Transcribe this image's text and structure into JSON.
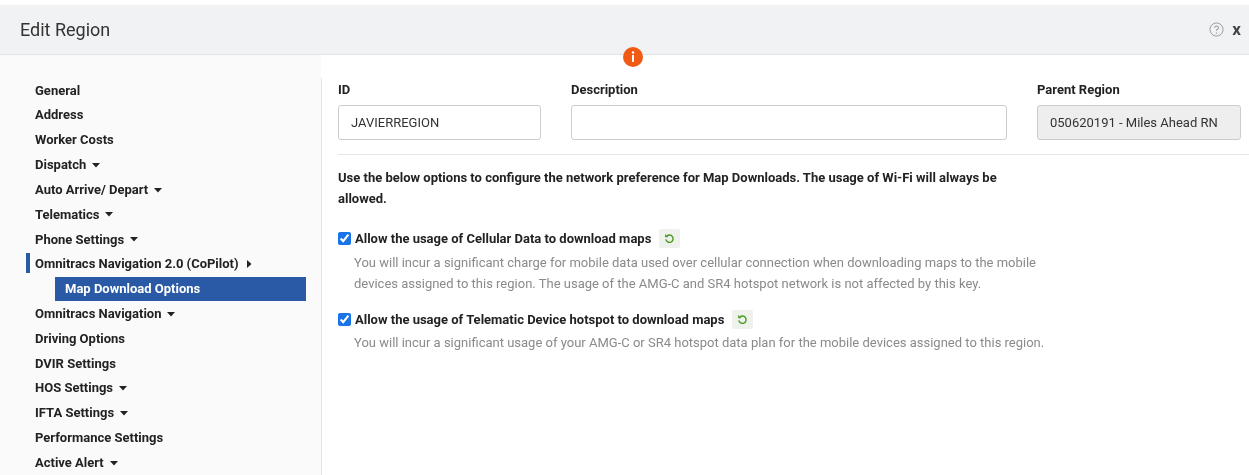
{
  "window": {
    "title": "Edit Region",
    "close": "x"
  },
  "sidebar": {
    "items": [
      {
        "label": "General",
        "kind": "plain",
        "selected": false
      },
      {
        "label": "Address",
        "kind": "plain",
        "selected": false
      },
      {
        "label": "Worker Costs",
        "kind": "plain",
        "selected": false
      },
      {
        "label": "Dispatch",
        "kind": "dropdown",
        "selected": false
      },
      {
        "label": "Auto Arrive/ Depart",
        "kind": "dropdown",
        "selected": false
      },
      {
        "label": "Telematics",
        "kind": "dropdown",
        "selected": false
      },
      {
        "label": "Phone Settings",
        "kind": "dropdown",
        "selected": false
      },
      {
        "label": "Omnitracs Navigation 2.0 (CoPilot)",
        "kind": "submenu",
        "selected": false,
        "children": [
          {
            "label": "Map Download Options",
            "selected": true
          }
        ]
      },
      {
        "label": "Omnitracs Navigation",
        "kind": "dropdown",
        "selected": false
      },
      {
        "label": "Driving Options",
        "kind": "plain",
        "selected": false
      },
      {
        "label": "DVIR Settings",
        "kind": "plain",
        "selected": false
      },
      {
        "label": "HOS Settings",
        "kind": "dropdown",
        "selected": false
      },
      {
        "label": "IFTA Settings",
        "kind": "dropdown",
        "selected": false
      },
      {
        "label": "Performance Settings",
        "kind": "plain",
        "selected": false
      },
      {
        "label": "Active Alert",
        "kind": "dropdown",
        "selected": false
      }
    ]
  },
  "fields": [
    {
      "label": "ID",
      "value": "JAVIERREGION",
      "disabled": false
    },
    {
      "label": "Description",
      "disabled": false
    },
    {
      "label": "Parent Region",
      "value": "050620191 - Miles Ahead RN",
      "disabled": true
    }
  ],
  "intro": "Use the below options to configure the network preference for Map Downloads. The usage of Wi-Fi will always be allowed.",
  "options": [
    {
      "label": "Allow the usage of Cellular Data to download maps",
      "checked": true,
      "description": "You will incur a significant charge for mobile data used over cellular connection when downloading maps to the mobile devices assigned to this region. The usage of the AMG-C and SR4 hotspot network is not affected by this key."
    },
    {
      "label": "Allow the usage of Telematic Device hotspot to download maps",
      "checked": true,
      "description": "You will incur a significant usage of your AMG-C or SR4 hotspot data plan for the mobile devices assigned to this region."
    }
  ]
}
